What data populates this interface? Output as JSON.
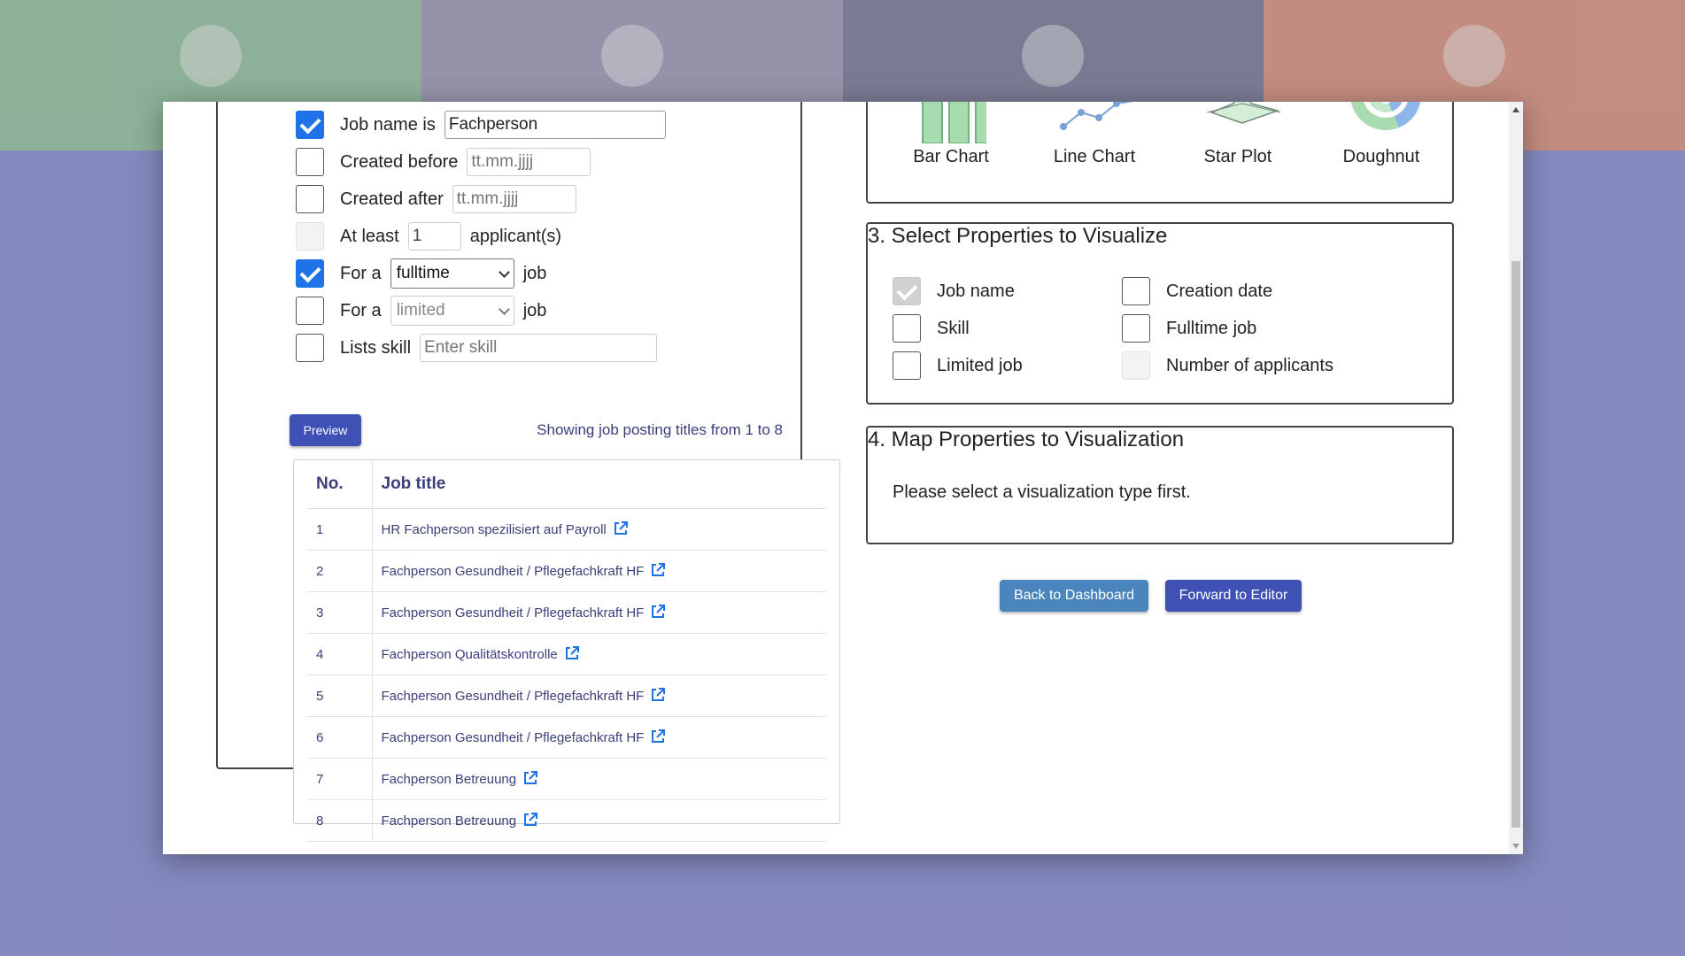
{
  "background": {
    "tile_colors": [
      "#96c7a5",
      "#a39dbd",
      "#7b7d9e",
      "#e09584"
    ]
  },
  "filters": {
    "job_name": {
      "label": "Job name is",
      "value": "Fachperson",
      "checked": true
    },
    "created_before": {
      "label": "Created before",
      "placeholder": "tt.mm.jjjj"
    },
    "created_after": {
      "label": "Created after",
      "placeholder": "tt.mm.jjjj"
    },
    "at_least": {
      "label": "At least",
      "value": "1",
      "suffix": "applicant(s)"
    },
    "for_a_fulltime": {
      "label": "For a",
      "value": "fulltime",
      "suffix": "job",
      "checked": true
    },
    "for_a_limited": {
      "label": "For a",
      "value": "limited",
      "suffix": "job"
    },
    "lists_skill": {
      "label": "Lists skill",
      "placeholder": "Enter skill"
    }
  },
  "preview_button": "Preview",
  "showing_text": "Showing job posting titles from 1 to 8",
  "table": {
    "headers": {
      "no": "No.",
      "title": "Job title"
    },
    "rows": [
      {
        "no": "1",
        "title": "HR Fachperson spezilisiert auf Payroll"
      },
      {
        "no": "2",
        "title": "Fachperson Gesundheit / Pflegefachkraft HF"
      },
      {
        "no": "3",
        "title": "Fachperson Gesundheit / Pflegefachkraft HF"
      },
      {
        "no": "4",
        "title": "Fachperson Qualitätskontrolle"
      },
      {
        "no": "5",
        "title": "Fachperson Gesundheit / Pflegefachkraft HF"
      },
      {
        "no": "6",
        "title": "Fachperson Gesundheit / Pflegefachkraft HF"
      },
      {
        "no": "7",
        "title": "Fachperson Betreuung"
      },
      {
        "no": "8",
        "title": "Fachperson Betreuung"
      }
    ]
  },
  "viz_types": {
    "bar": "Bar Chart",
    "line": "Line Chart",
    "star": "Star Plot",
    "doughnut": "Doughnut"
  },
  "properties": {
    "title": "3. Select Properties to Visualize",
    "job_name": "Job name",
    "creation_date": "Creation date",
    "skill": "Skill",
    "fulltime_job": "Fulltime job",
    "limited_job": "Limited job",
    "num_applicants": "Number of applicants"
  },
  "map": {
    "title": "4. Map Properties to Visualization",
    "message": "Please select a visualization type first."
  },
  "buttons": {
    "back": "Back to Dashboard",
    "forward": "Forward to Editor"
  },
  "colors": {
    "accent": "#3f51b5",
    "secondary_button": "#4a86bd",
    "checkbox": "#1e73e8",
    "link_text": "#3a3f7a"
  }
}
